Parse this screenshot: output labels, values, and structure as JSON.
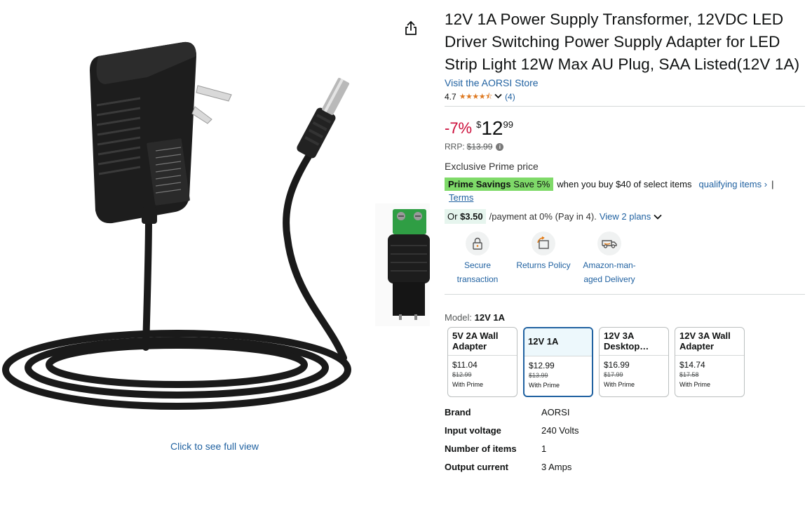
{
  "image_area": {
    "full_view_link": "Click to see full view"
  },
  "product": {
    "title": "12V 1A Power Supply Transformer, 12VDC LED Driver Switching Power Supply Adapter for LED Strip Light 12W Max AU Plug, SAA Listed(12V 1A)",
    "store_link": "Visit the AORSI Store",
    "rating": "4.7",
    "review_count": "(4)",
    "discount": "-7%",
    "price_currency": "$",
    "price_whole": "12",
    "price_fraction": "99",
    "rrp_label": "RRP:",
    "rrp_value": "$13.99",
    "exclusive_prime": "Exclusive Prime price",
    "prime_savings_label": "Prime Savings",
    "prime_savings_value": "Save 5%",
    "prime_condition": "when you buy $40 of select items",
    "qualifying_link": "qualifying items ›",
    "separator": "|",
    "terms_link": "Terms",
    "or_label": "Or",
    "installment_amount": "$3.50",
    "installment_text": "/payment at 0% (Pay in 4).",
    "plans_link": "View 2 plans"
  },
  "features": [
    {
      "label1": "Secure",
      "label2": "transaction"
    },
    {
      "label1": "Returns Policy",
      "label2": ""
    },
    {
      "label1": "Amazon-man-",
      "label2": "aged Delivery"
    }
  ],
  "model": {
    "label": "Model:",
    "selected": "12V 1A",
    "options": [
      {
        "name1": "5V 2A Wall",
        "name2": "Adapter",
        "price": "$11.04",
        "rrp": "$12.99",
        "prime": "With Prime"
      },
      {
        "name1": "12V 1A",
        "name2": "",
        "price": "$12.99",
        "rrp": "$13.99",
        "prime": "With Prime"
      },
      {
        "name1": "12V 3A",
        "name2": "Desktop…",
        "price": "$16.99",
        "rrp": "$17.99",
        "prime": "With Prime"
      },
      {
        "name1": "12V 3A Wall",
        "name2": "Adapter",
        "price": "$14.74",
        "rrp": "$17.58",
        "prime": "With Prime"
      }
    ]
  },
  "specs": [
    {
      "key": "Brand",
      "value": "AORSI"
    },
    {
      "key": "Input voltage",
      "value": "240 Volts"
    },
    {
      "key": "Number of items",
      "value": "1"
    },
    {
      "key": "Output current",
      "value": "3 Amps"
    }
  ],
  "colors": {
    "link": "#2162a1",
    "discount": "#cc0c39",
    "prime_badge": "#7fda69",
    "stars": "#de7921"
  }
}
